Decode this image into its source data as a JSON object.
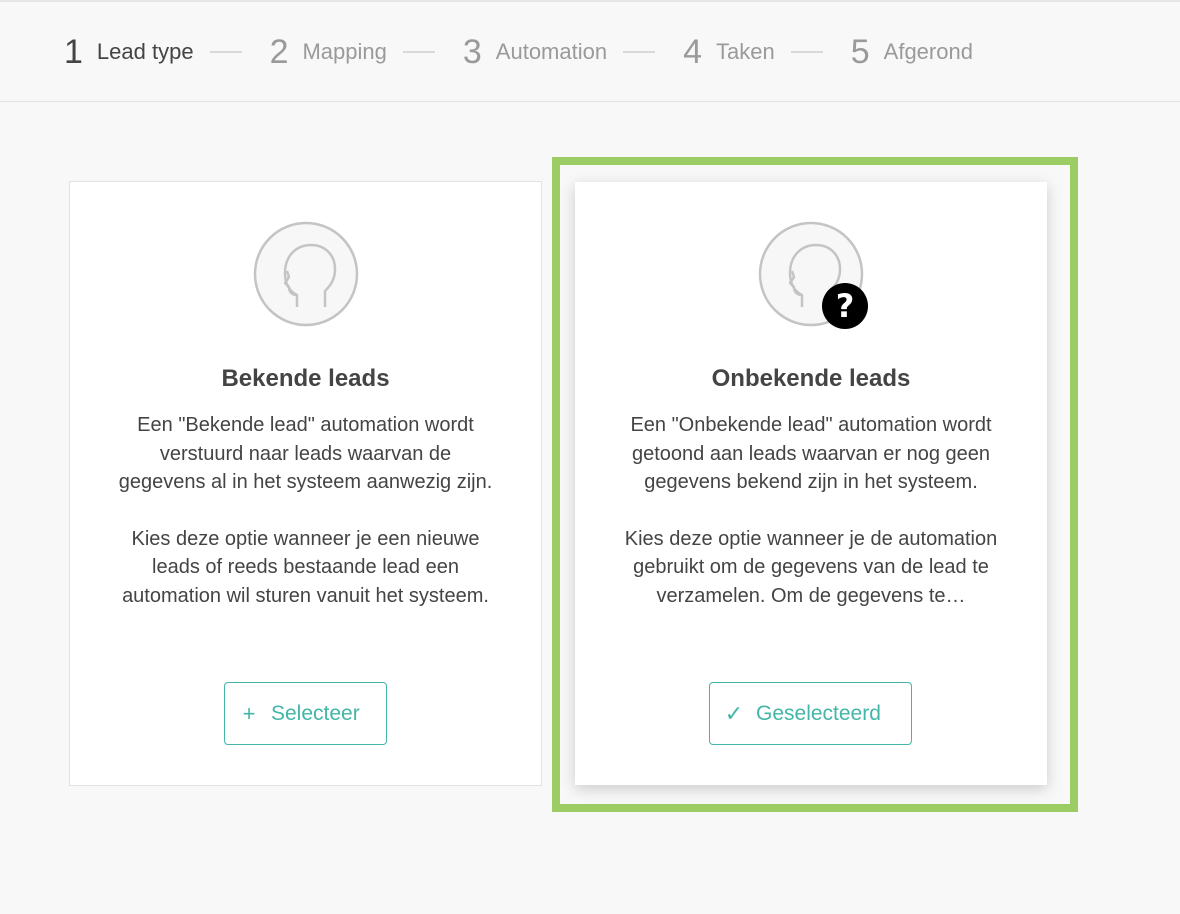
{
  "stepper": {
    "steps": [
      {
        "num": "1",
        "label": "Lead type"
      },
      {
        "num": "2",
        "label": "Mapping"
      },
      {
        "num": "3",
        "label": "Automation"
      },
      {
        "num": "4",
        "label": "Taken"
      },
      {
        "num": "5",
        "label": "Afgerond"
      }
    ]
  },
  "cards": {
    "known": {
      "title": "Bekende leads",
      "desc1": "Een \"Bekende lead\" automation wordt verstuurd naar leads waarvan de gegevens al in het systeem aanwezig zijn.",
      "desc2": "Kies deze optie wanneer je een nieuwe leads of reeds bestaande lead een automation wil sturen vanuit het systeem.",
      "button_label": "Selecteer",
      "button_icon": "plus-icon"
    },
    "unknown": {
      "title": "Onbekende leads",
      "desc1": "Een \"Onbekende lead\" automation wordt getoond aan leads waarvan er nog geen gegevens bekend zijn in het systeem.",
      "desc2": "Kies deze optie wanneer je de automation gebruikt om de gegevens van de lead te verzamelen. Om de gegevens te…",
      "button_label": "Geselecteerd",
      "button_icon": "check-icon",
      "badge": "?"
    }
  },
  "colors": {
    "accent": "#43b6a7",
    "highlight": "#9ccd64"
  }
}
